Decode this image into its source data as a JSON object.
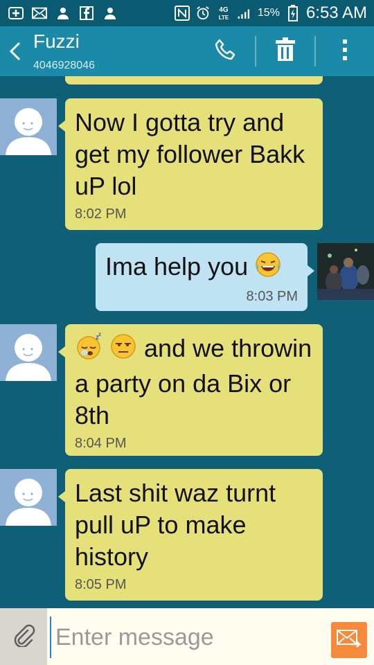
{
  "status_bar": {
    "battery_percent": "15%",
    "time": "6:53 AM",
    "network": "4G LTE",
    "icons": [
      "add-icon",
      "mail-icon",
      "person-icon",
      "facebook-icon",
      "person-icon",
      "nfc-icon",
      "alarm-icon",
      "lte-icon",
      "signal-icon",
      "battery-charging-icon"
    ]
  },
  "header": {
    "contact_name": "Fuzzi",
    "contact_number": "4046928046",
    "actions": [
      "phone-icon",
      "delete-icon",
      "more-options-icon"
    ]
  },
  "messages": [
    {
      "direction": "incoming",
      "text": "Now I gotta try and get my follower Bakk uP lol",
      "time": "8:02 PM"
    },
    {
      "direction": "outgoing",
      "text": "Ima help you",
      "emoji": "tears-of-joy",
      "time": "8:03 PM"
    },
    {
      "direction": "incoming",
      "text": "and we throwin a party on da Bix or 8th",
      "emoji_prefix": [
        "sleeping-face",
        "unamused-face"
      ],
      "time": "8:04 PM"
    },
    {
      "direction": "incoming",
      "text": "Last shit waz turnt pull uP to make history",
      "time": "8:05 PM"
    }
  ],
  "composer": {
    "placeholder": "Enter message",
    "value": ""
  },
  "colors": {
    "status_bar": "#0a5a72",
    "action_bar": "#1a8aa8",
    "thread_background": "#0f6077",
    "incoming_bubble": "#e6e07a",
    "outgoing_bubble": "#bfe3f3",
    "send_button": "#f58a3c"
  }
}
